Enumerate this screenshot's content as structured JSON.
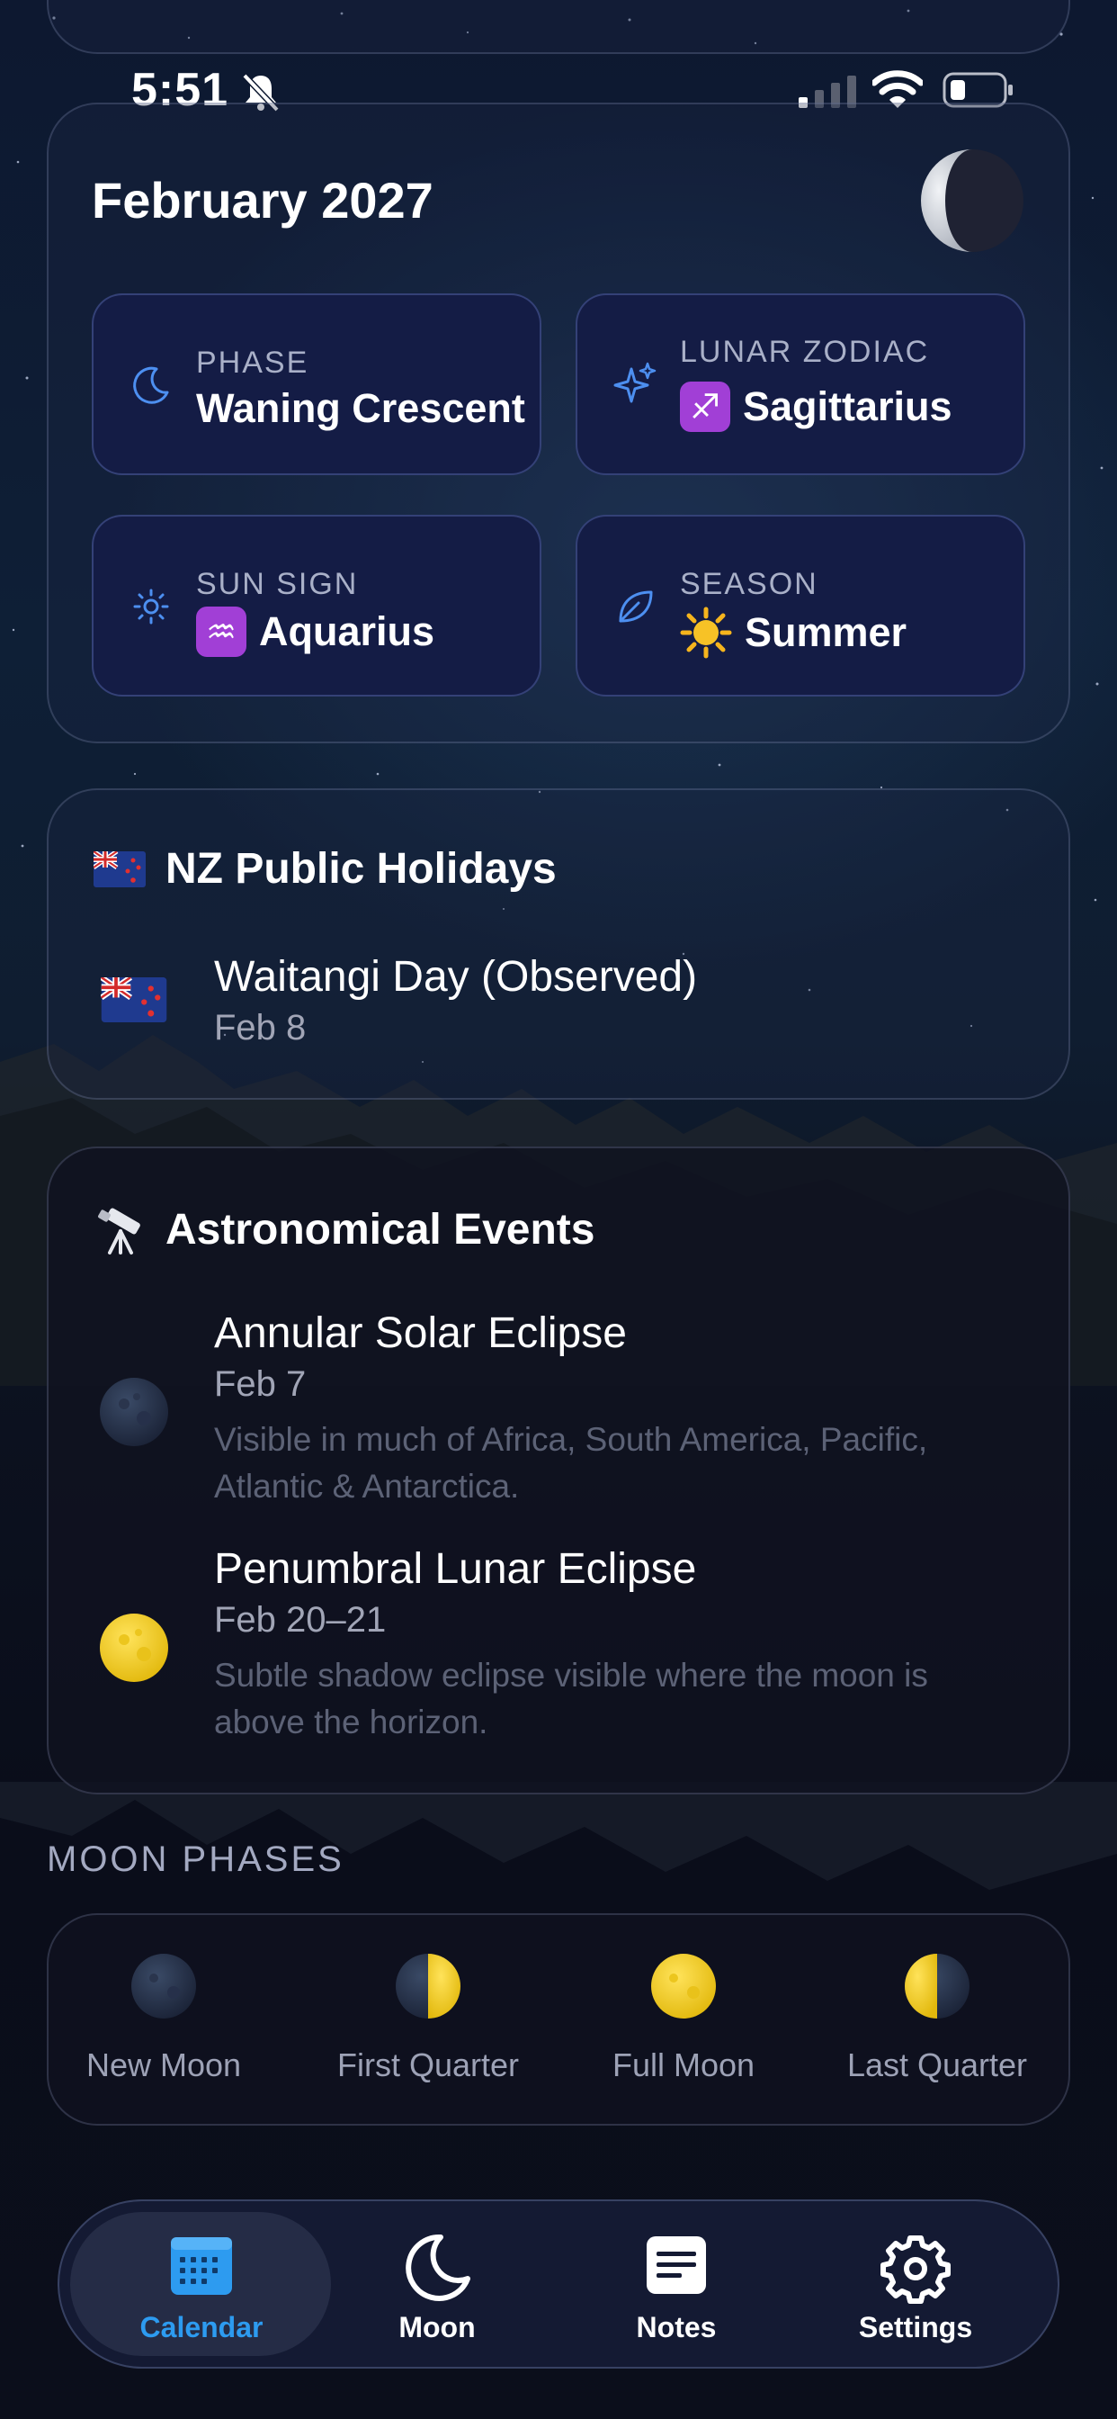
{
  "status_bar": {
    "time": "5:51"
  },
  "month_card": {
    "title": "February 2027",
    "tiles": [
      {
        "label": "PHASE",
        "value": "Waning Crescent",
        "icon": "crescent-moon-icon"
      },
      {
        "label": "LUNAR ZODIAC",
        "value": "Sagittarius",
        "badge": "♐",
        "icon": "sparkles-icon"
      },
      {
        "label": "SUN SIGN",
        "value": "Aquarius",
        "badge": "♒",
        "icon": "sun-icon"
      },
      {
        "label": "SEASON",
        "value": "Summer",
        "badge": "sun-emoji",
        "icon": "leaf-icon"
      }
    ]
  },
  "holidays": {
    "title": "NZ Public Holidays",
    "items": [
      {
        "name": "Waitangi Day (Observed)",
        "date": "Feb 8"
      }
    ]
  },
  "astro": {
    "title": "Astronomical Events",
    "events": [
      {
        "name": "Annular Solar Eclipse",
        "date": "Feb 7",
        "description": "Visible in much of Africa, South America, Pacific, Atlantic & Antarctica.",
        "icon": "new-moon-icon"
      },
      {
        "name": "Penumbral Lunar Eclipse",
        "date": "Feb 20–21",
        "description": "Subtle shadow eclipse visible where the moon is above the horizon.",
        "icon": "full-moon-icon"
      }
    ]
  },
  "moon_phases": {
    "label": "MOON PHASES",
    "items": [
      "New Moon",
      "First Quarter",
      "Full Moon",
      "Last Quarter"
    ]
  },
  "tabbar": {
    "active": "Calendar",
    "tabs": [
      {
        "label": "Calendar",
        "icon": "calendar-icon"
      },
      {
        "label": "Moon",
        "icon": "moon-icon"
      },
      {
        "label": "Notes",
        "icon": "notes-icon"
      },
      {
        "label": "Settings",
        "icon": "gear-icon"
      }
    ]
  },
  "colors": {
    "accent": "#2d9bf0",
    "tile_bg": "#141c45",
    "zodiac_badge": "#a13fd6",
    "moon_yellow": "#f3d22c"
  }
}
